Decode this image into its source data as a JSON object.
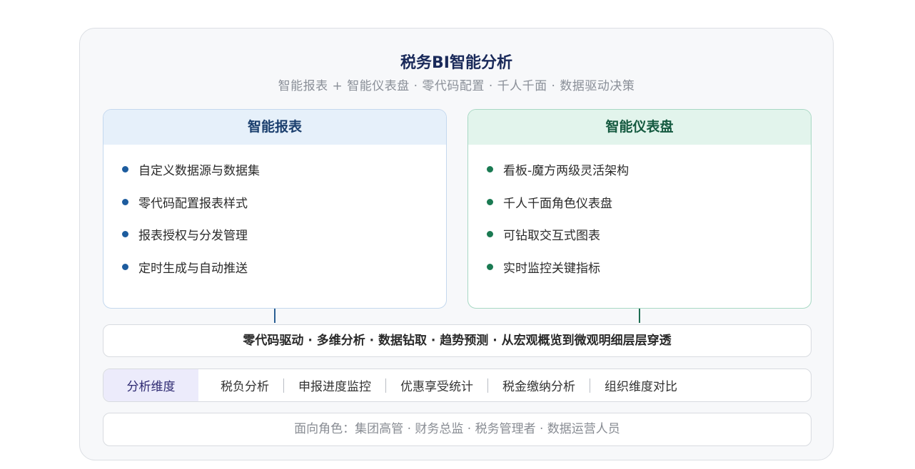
{
  "header": {
    "title": "税务BI智能分析",
    "subtitle": "智能报表 + 智能仪表盘 · 零代码配置 · 千人千面 · 数据驱动决策"
  },
  "cards": [
    {
      "title": "智能报表",
      "items": [
        "自定义数据源与数据集",
        "零代码配置报表样式",
        "报表授权与分发管理",
        "定时生成与自动推送"
      ]
    },
    {
      "title": "智能仪表盘",
      "items": [
        "看板-魔方两级灵活架构",
        "千人千面角色仪表盘",
        "可钻取交互式图表",
        "实时监控关键指标"
      ]
    }
  ],
  "capabilities": "零代码驱动 · 多维分析 · 数据钻取 · 趋势预测 · 从宏观概览到微观明细层层穿透",
  "dimensions": {
    "label": "分析维度",
    "items": [
      "税负分析",
      "申报进度监控",
      "优惠享受统计",
      "税金缴纳分析",
      "组织维度对比"
    ]
  },
  "roles": "面向角色：集团高管 · 财务总监 · 税务管理者 · 数据运营人员",
  "colors": {
    "title": "#1a2a5a",
    "blue_accent": "#1d5c9e",
    "green_accent": "#1a7a52",
    "dimension_label_bg": "#ecebfb"
  }
}
